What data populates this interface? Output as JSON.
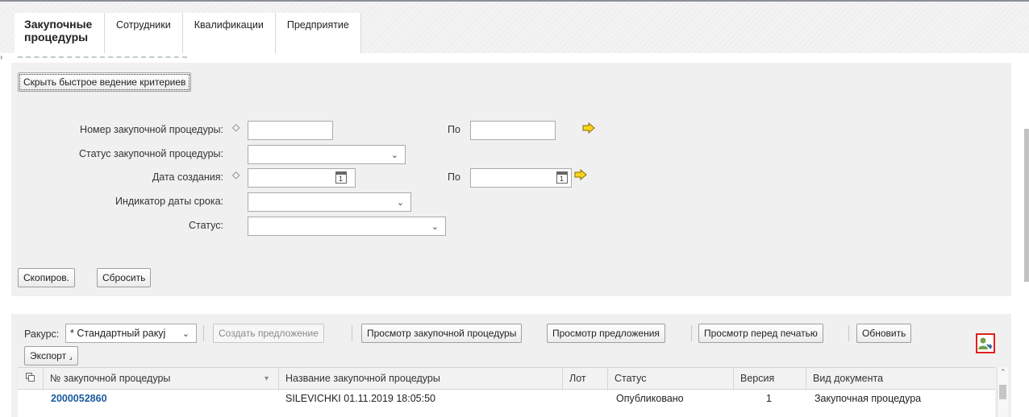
{
  "tabs": [
    {
      "label": "Закупочные процедуры",
      "active": true
    },
    {
      "label": "Сотрудники",
      "active": false
    },
    {
      "label": "Квалификации",
      "active": false
    },
    {
      "label": "Предприятие",
      "active": false
    }
  ],
  "criteria": {
    "hide_button": "Скрыть быстрое ведение критериев",
    "fields": {
      "proc_number_label": "Номер закупочной процедуры:",
      "proc_number_value": "",
      "proc_number_to_label": "По",
      "proc_number_to_value": "",
      "proc_status_label": "Статус закупочной процедуры:",
      "proc_status_value": "",
      "created_label": "Дата создания:",
      "created_value": "",
      "created_to_label": "По",
      "created_to_value": "",
      "deadline_label": "Индикатор даты срока:",
      "deadline_value": "",
      "status_label": "Статус:",
      "status_value": ""
    },
    "copy_button": "Скопиров.",
    "reset_button": "Сбросить"
  },
  "toolbar": {
    "view_label": "Ракурс:",
    "view_value": "* Стандартный ракуј",
    "create_offer": "Создать предложение",
    "view_procedure": "Просмотр закупочной процедуры",
    "view_offers": "Просмотр предложения",
    "print_preview": "Просмотр перед печатью",
    "refresh": "Обновить",
    "export": "Экспорт"
  },
  "table": {
    "columns": [
      "№ закупочной процедуры",
      "Название закупочной процедуры",
      "Лот",
      "Статус",
      "Версия",
      "Вид документа"
    ],
    "rows": [
      {
        "number": "2000052860",
        "name": "SILEVICHKI 01.11.2019 18:05:50",
        "lot": "",
        "status": "Опубликовано",
        "version": "1",
        "doc_type": "Закупочная процедура"
      }
    ]
  },
  "colors": {
    "accent_link": "#1a5b9e",
    "highlight_box": "#e0201b",
    "panel_bg": "#f0f0f0"
  }
}
